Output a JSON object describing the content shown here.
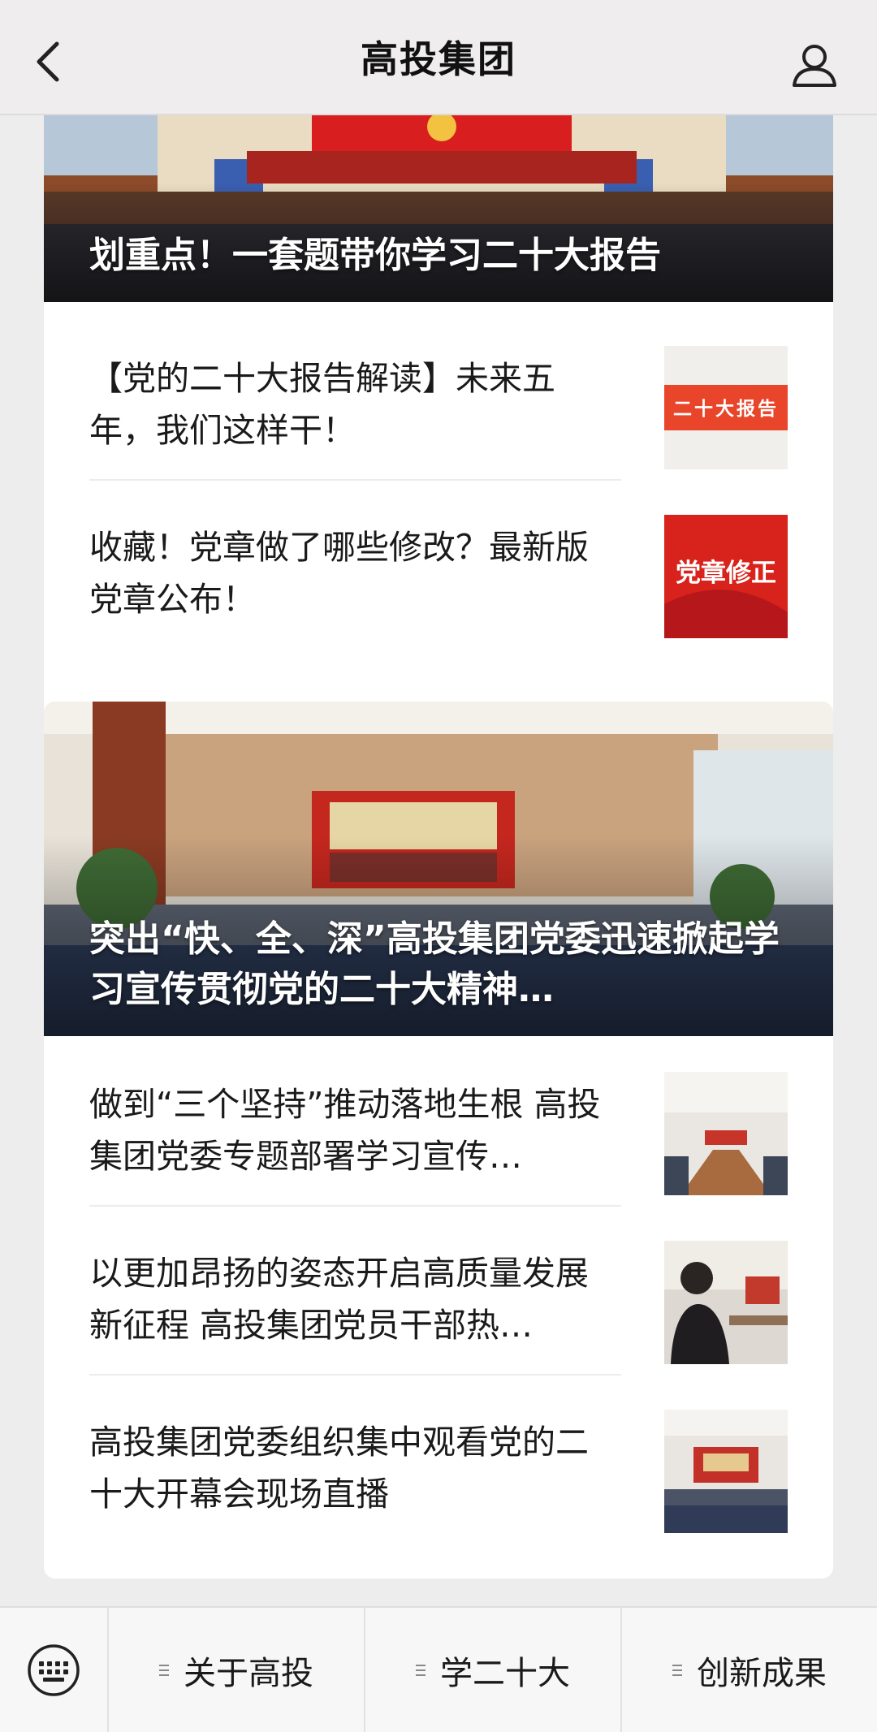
{
  "header": {
    "title": "高投集团",
    "back_icon": "chevron-left-icon",
    "profile_icon": "user-icon"
  },
  "card1": {
    "banner_caption": "划重点！一套题带你学习二十大报告",
    "items": [
      {
        "title": "【党的二十大报告解读】未来五年，我们这样干！",
        "thumb_text": "二十大报告"
      },
      {
        "title": "收藏！党章做了哪些修改？最新版党章公布！",
        "thumb_text": "党章修正"
      }
    ]
  },
  "card2": {
    "banner_caption": "突出“快、全、深”高投集团党委迅速掀起学习宣传贯彻党的二十大精神…",
    "items": [
      {
        "title": "做到“三个坚持”推动落地生根 高投集团党委专题部署学习宣传…"
      },
      {
        "title": "以更加昂扬的姿态开启高质量发展新征程 高投集团党员干部热…"
      },
      {
        "title": "高投集团党委组织集中观看党的二十大开幕会现场直播"
      }
    ]
  },
  "bottom_menu": {
    "keyboard_icon": "keyboard-icon",
    "items": [
      {
        "label": "关于高投"
      },
      {
        "label": "学二十大"
      },
      {
        "label": "创新成果"
      }
    ]
  },
  "colors": {
    "party_red": "#d8231c",
    "background": "#ededed"
  }
}
